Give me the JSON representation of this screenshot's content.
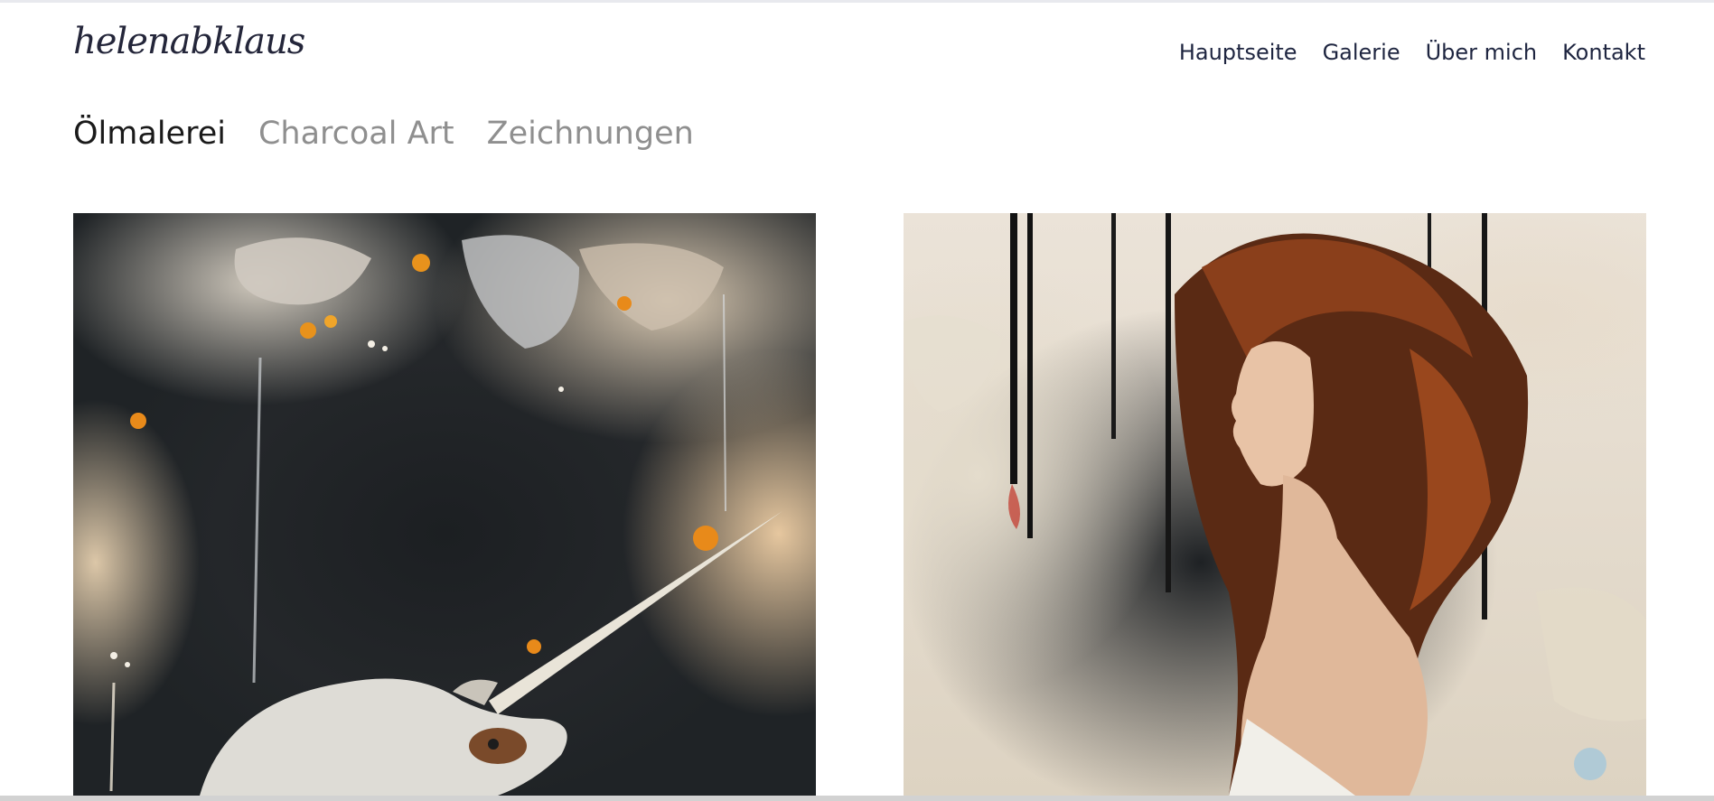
{
  "logo": {
    "text": "helenabklaus"
  },
  "nav": {
    "items": [
      "Hauptseite",
      "Galerie",
      "Über mich",
      "Kontakt"
    ]
  },
  "gallery_tabs": {
    "items": [
      "Ölmalerei",
      "Charcoal Art",
      "Zeichnungen"
    ],
    "active": "Ölmalerei"
  },
  "artworks": [
    {
      "subject": "abstract oil painting with white horse and unicorn horn"
    },
    {
      "subject": "oil portrait of red-haired woman in profile"
    }
  ],
  "colors": {
    "text_dark": "#1e2540",
    "tab_inactive": "#8f8f8f",
    "accent_orange": "#e88a1a"
  }
}
